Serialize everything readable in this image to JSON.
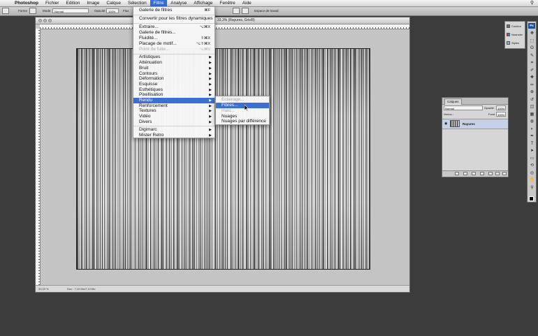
{
  "menubar": {
    "apple_icon": "apple-logo-icon",
    "items": [
      "Photoshop",
      "Fichier",
      "Edition",
      "Image",
      "Calque",
      "Sélection",
      "Filtre",
      "Analyse",
      "Affichage",
      "Fenêtre",
      "Aide"
    ],
    "active_item": "Filtre",
    "spotlight_icon": "magnifier-icon"
  },
  "options_bar": {
    "forme_label": "Forme",
    "mode_label": "Mode",
    "mode_value": "Normal",
    "opacite_label": "Opacité",
    "opacite_value": "100%",
    "flux_label": "Flux",
    "workspace_label": "Espace de travail"
  },
  "document": {
    "title": "33,3% (Rayures, Gris/8)",
    "zoom": "33,33 %",
    "doc_info": "Doc : 7,10 Mo/7,10 Mo"
  },
  "filtre_menu": {
    "last_filter": "Galerie de filtres",
    "last_filter_shortcut": "⌘F",
    "convert_smart": "Convertir pour les filtres dynamiques",
    "group1": [
      {
        "label": "Extraire...",
        "shortcut": "⌥⌘X",
        "enabled": true
      },
      {
        "label": "Galerie de filtres...",
        "shortcut": "",
        "enabled": true
      },
      {
        "label": "Fluidité...",
        "shortcut": "⇧⌘X",
        "enabled": true
      },
      {
        "label": "Placage de motif...",
        "shortcut": "⌥⇧⌘X",
        "enabled": true
      },
      {
        "label": "Point de fuite...",
        "shortcut": "⌥⌘V",
        "enabled": false
      }
    ],
    "categories": [
      "Artistiques",
      "Atténuation",
      "Bruit",
      "Contours",
      "Déformation",
      "Esquisse",
      "Esthétiques",
      "Pixellisation",
      "Rendu",
      "Renforcement",
      "Textures",
      "Vidéo",
      "Divers"
    ],
    "highlighted_category": "Rendu",
    "plugins": [
      "Digimarc",
      "Mister Retro"
    ]
  },
  "rendu_submenu": {
    "items": [
      {
        "label": "Eclairage...",
        "enabled": false
      },
      {
        "label": "Fibres...",
        "enabled": true,
        "highlighted": true
      },
      {
        "label": "Halo...",
        "enabled": false
      },
      {
        "label": "Nuages",
        "enabled": true
      },
      {
        "label": "Nuages par différence",
        "enabled": true
      }
    ]
  },
  "mini_panel": {
    "items": [
      {
        "label": "Couleur",
        "icon": "color-icon"
      },
      {
        "label": "Nuancier",
        "icon": "swatches-icon"
      },
      {
        "label": "Styles",
        "icon": "styles-icon"
      }
    ]
  },
  "tools": {
    "logo": "Ps",
    "icons": [
      "move-icon",
      "marquee-icon",
      "lasso-icon",
      "quick-select-icon",
      "crop-icon",
      "eyedropper-icon",
      "healing-icon",
      "brush-icon",
      "stamp-icon",
      "history-brush-icon",
      "eraser-icon",
      "gradient-icon",
      "blur-icon",
      "dodge-icon",
      "pen-icon",
      "type-icon",
      "path-select-icon",
      "shape-icon",
      "3d-rotate-icon",
      "3d-orbit-icon",
      "hand-icon",
      "zoom-icon"
    ],
    "glyphs": [
      "✥",
      "⬚",
      "ʘ",
      "✎",
      "⌗",
      "✐",
      "✚",
      "✏",
      "⊕",
      "↺",
      "◫",
      "▦",
      "◍",
      "◐",
      "✒",
      "T",
      "➤",
      "▭",
      "⟲",
      "◎",
      "✋",
      "⚲"
    ]
  },
  "layers_panel": {
    "tab": "Calques",
    "blend_mode": "Normal",
    "opacite_label": "Opacité",
    "opacite_value": "100%",
    "verrou_label": "Verrou :",
    "fond_label": "Fond",
    "fond_value": "100%",
    "layer_name": "Rayures",
    "colors": {
      "selected_row": "#c5d1e6"
    }
  },
  "colors": {
    "accent": "#3a6fd6",
    "desktop": "#3c3c3c",
    "foreground": "#000000"
  }
}
